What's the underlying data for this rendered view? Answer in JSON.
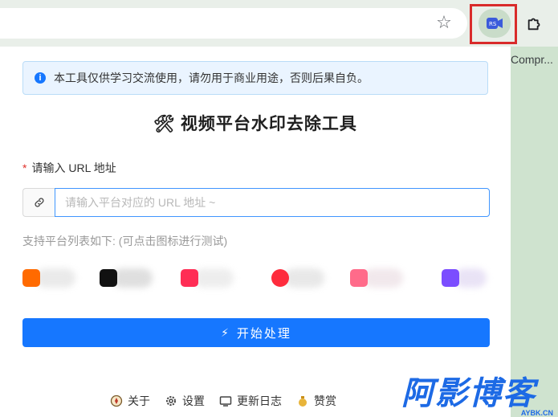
{
  "browser": {
    "side_text": "Compr..."
  },
  "notice": {
    "text": "本工具仅供学习交流使用，请勿用于商业用途，否则后果自负。"
  },
  "title": "视频平台水印去除工具",
  "form": {
    "required_mark": "*",
    "label": "请输入 URL 地址",
    "placeholder": "请输入平台对应的 URL 地址 ~",
    "value": ""
  },
  "platforms": {
    "caption": "支持平台列表如下: (可点击图标进行测试)",
    "items": [
      {
        "icon": "orange-platform-icon",
        "color": "#ff6a00"
      },
      {
        "icon": "tiktok-icon",
        "color": "#111111"
      },
      {
        "icon": "red-platform-icon",
        "color": "#ff2d55"
      },
      {
        "icon": "play-platform-icon",
        "color": "#fe2c3d"
      },
      {
        "icon": "pink-platform-icon",
        "color": "#ff6b8a"
      },
      {
        "icon": "purple-platform-icon",
        "color": "#7b4dff"
      }
    ]
  },
  "start_button": "开始处理",
  "footer": {
    "about": "关于",
    "settings": "设置",
    "changelog": "更新日志",
    "donate": "赞赏"
  },
  "watermark": {
    "text": "阿影博客",
    "sub": "AYBK.CN"
  },
  "colors": {
    "primary": "#1677ff",
    "highlight": "#d92b2b",
    "notice_bg": "#eaf4ff"
  }
}
